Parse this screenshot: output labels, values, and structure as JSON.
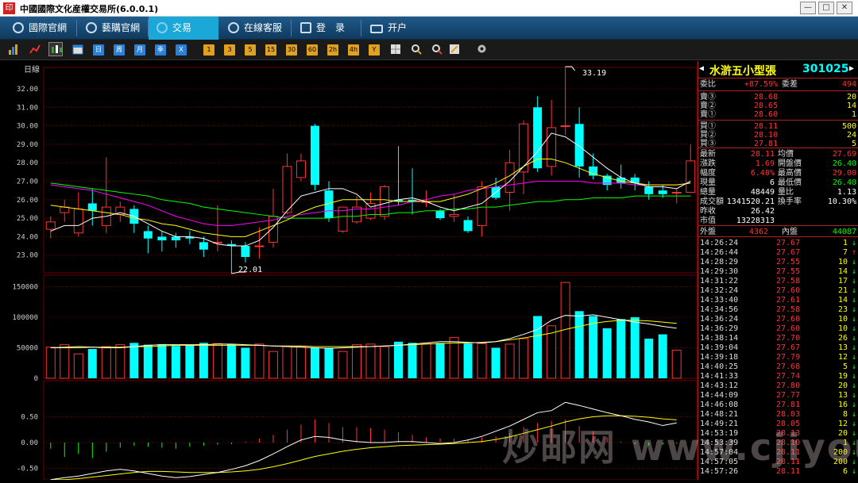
{
  "window": {
    "title": "中國國際文化産權交易所(6.0.0.1)",
    "minimize": "—",
    "maximize": "□",
    "close": "✕"
  },
  "nav": {
    "tabs": [
      {
        "label": "國際官網",
        "icon": "globe-icon"
      },
      {
        "label": "藝購官網",
        "icon": "link-icon"
      },
      {
        "label": "交易",
        "icon": "dollar-icon"
      },
      {
        "label": "在線客服",
        "icon": "chat-icon"
      },
      {
        "label": "登　录",
        "icon": "login-icon"
      },
      {
        "label": "开户",
        "icon": "account-icon"
      }
    ]
  },
  "toolbar": {
    "period_buttons": [
      "日",
      "周",
      "月",
      "季",
      "X"
    ],
    "minute_buttons": [
      "1",
      "3",
      "5",
      "15",
      "30",
      "60",
      "2h",
      "4h",
      "Y"
    ]
  },
  "chart": {
    "period_label": "日線",
    "price_axis": [
      "32.00",
      "31.00",
      "30.00",
      "29.00",
      "28.00",
      "27.00",
      "26.00",
      "25.00",
      "24.00",
      "23.00"
    ],
    "volume_axis": [
      "150000",
      "100000",
      "50000",
      "0"
    ],
    "indicator_axis": [
      "0.50",
      "0.00",
      "-0.50"
    ],
    "high_label": "33.19",
    "low_label": "22.01",
    "colors": {
      "up": "#ff3333",
      "down": "#00ffff",
      "ma5": "#ffffff",
      "ma10": "#ffff00",
      "ma20": "#ff00ff",
      "ma60": "#00ff00",
      "grid": "#6a0000"
    }
  },
  "chart_data": {
    "type": "candlestick",
    "ylim": [
      22.5,
      33.2
    ],
    "candles": [
      [
        24.4,
        24.8,
        23.9,
        25.1
      ],
      [
        25.3,
        25.6,
        24.8,
        26.0
      ],
      [
        24.2,
        25.5,
        24.0,
        26.4
      ],
      [
        25.8,
        25.4,
        24.6,
        26.6
      ],
      [
        24.6,
        25.6,
        24.2,
        28.3
      ],
      [
        25.2,
        25.6,
        24.8,
        25.9
      ],
      [
        25.5,
        24.7,
        24.2,
        25.7
      ],
      [
        24.3,
        23.9,
        23.1,
        24.6
      ],
      [
        24.0,
        23.8,
        23.2,
        24.3
      ],
      [
        24.0,
        23.8,
        23.4,
        24.2
      ],
      [
        24.0,
        23.9,
        23.6,
        24.3
      ],
      [
        23.7,
        23.3,
        22.9,
        24.0
      ],
      [
        23.7,
        23.7,
        23.2,
        25.7
      ],
      [
        23.6,
        23.5,
        22.0,
        23.8
      ],
      [
        23.5,
        22.9,
        22.6,
        23.7
      ],
      [
        23.5,
        23.5,
        22.8,
        24.5
      ],
      [
        23.7,
        25.1,
        23.4,
        26.6
      ],
      [
        25.3,
        27.8,
        25.2,
        28.5
      ],
      [
        27.2,
        28.1,
        27.0,
        28.5
      ],
      [
        30.0,
        26.8,
        26.5,
        30.1
      ],
      [
        26.5,
        25.0,
        24.8,
        27.0
      ],
      [
        24.3,
        25.6,
        24.2,
        25.6
      ],
      [
        24.8,
        25.6,
        24.7,
        26.2
      ],
      [
        25.0,
        25.8,
        24.9,
        26.4
      ],
      [
        25.1,
        26.7,
        24.9,
        26.8
      ],
      [
        26.0,
        25.9,
        25.7,
        28.9
      ],
      [
        26.0,
        25.9,
        25.2,
        27.7
      ],
      [
        25.9,
        25.9,
        25.6,
        26.5
      ],
      [
        25.4,
        25.0,
        24.9,
        25.5
      ],
      [
        25.1,
        25.2,
        24.8,
        26.3
      ],
      [
        24.9,
        24.3,
        24.2,
        25.1
      ],
      [
        24.6,
        26.7,
        24.0,
        27.0
      ],
      [
        26.7,
        26.1,
        26.0,
        27.2
      ],
      [
        26.4,
        28.0,
        25.4,
        28.7
      ],
      [
        27.5,
        30.1,
        26.3,
        30.3
      ],
      [
        31.0,
        27.7,
        27.5,
        31.6
      ],
      [
        27.8,
        29.9,
        27.3,
        31.4
      ],
      [
        30.0,
        30.0,
        29.5,
        33.2
      ],
      [
        30.1,
        27.8,
        27.2,
        31.0
      ],
      [
        27.8,
        27.3,
        27.1,
        28.5
      ],
      [
        27.3,
        26.8,
        26.5,
        27.4
      ],
      [
        27.2,
        26.9,
        26.6,
        27.9
      ],
      [
        27.2,
        26.9,
        26.5,
        27.4
      ],
      [
        26.7,
        26.3,
        26.0,
        27.0
      ],
      [
        26.5,
        26.3,
        26.1,
        26.8
      ],
      [
        26.4,
        26.4,
        25.8,
        26.6
      ],
      [
        26.4,
        28.1,
        26.4,
        29.0
      ]
    ],
    "volume": [
      51000,
      55000,
      40000,
      48000,
      52000,
      55000,
      58000,
      55000,
      56000,
      53000,
      54000,
      58000,
      57000,
      56000,
      50000,
      56000,
      44000,
      52000,
      52000,
      50000,
      50000,
      44000,
      55000,
      56000,
      52000,
      60000,
      58000,
      57000,
      58000,
      67000,
      57000,
      57000,
      50000,
      56000,
      65000,
      102000,
      86000,
      157000,
      110000,
      102000,
      82000,
      97000,
      100000,
      65000,
      72000,
      46000
    ],
    "ma5": [
      24.3,
      24.6,
      24.6,
      25.0,
      25.1,
      25.3,
      25.1,
      24.7,
      24.3,
      24.0,
      24.0,
      23.9,
      23.6,
      23.5,
      23.5,
      23.8,
      24.5,
      25.4,
      26.2,
      26.4,
      26.6,
      26.6,
      26.3,
      25.6,
      25.8,
      26.0,
      26.1,
      25.9,
      25.6,
      25.4,
      25.6,
      25.8,
      26.4,
      27.0,
      27.8,
      28.6,
      29.6,
      29.4,
      28.9,
      28.3,
      27.7,
      27.2,
      26.9,
      26.7,
      26.7,
      26.6,
      27.0
    ],
    "ma10": [
      25.7,
      25.6,
      25.5,
      25.4,
      25.3,
      25.2,
      25.0,
      24.9,
      24.7,
      24.6,
      24.4,
      24.2,
      24.1,
      24.0,
      24.0,
      24.3,
      24.6,
      24.9,
      25.3,
      25.6,
      25.8,
      26.0,
      26.0,
      26.0,
      26.0,
      25.9,
      25.9,
      25.9,
      25.9,
      26.1,
      26.3,
      26.6,
      26.9,
      27.3,
      27.8,
      28.2,
      28.2,
      28.0,
      27.7,
      27.4,
      27.2,
      27.0,
      26.9,
      26.8,
      26.8,
      26.8,
      26.9
    ],
    "ma20": [
      26.8,
      26.7,
      26.6,
      26.5,
      26.3,
      26.1,
      25.9,
      25.7,
      25.4,
      25.1,
      24.9,
      24.7,
      24.6,
      24.6,
      24.7,
      24.8,
      24.9,
      25.1,
      25.2,
      25.3,
      25.4,
      25.4,
      25.5,
      25.5,
      25.6,
      25.7,
      25.9,
      26.0,
      26.2,
      26.3,
      26.5,
      26.6,
      26.7,
      26.8,
      26.9,
      27.0,
      27.0,
      27.0,
      27.0,
      26.9,
      26.9,
      26.9,
      26.8,
      26.8,
      26.8,
      26.8,
      26.9
    ],
    "ma60": [
      26.9,
      26.8,
      26.7,
      26.6,
      26.5,
      26.4,
      26.3,
      26.2,
      26.0,
      25.9,
      25.8,
      25.6,
      25.5,
      25.4,
      25.3,
      25.2,
      25.1,
      25.0,
      25.0,
      25.0,
      25.0,
      25.1,
      25.1,
      25.2,
      25.2,
      25.3,
      25.3,
      25.4,
      25.4,
      25.5,
      25.5,
      25.6,
      25.6,
      25.7,
      25.8,
      25.9,
      25.9,
      26.0,
      26.0,
      26.1,
      26.1,
      26.1,
      26.2,
      26.2,
      26.2,
      26.2,
      26.2
    ],
    "vol_ma5": [
      50000,
      51000,
      52000,
      51000,
      50000,
      50000,
      52000,
      54000,
      55000,
      55000,
      55000,
      55000,
      56000,
      56000,
      55000,
      54000,
      53000,
      52000,
      51000,
      50000,
      49000,
      50000,
      51000,
      52000,
      53000,
      54000,
      56000,
      58000,
      60000,
      60000,
      59000,
      58000,
      60000,
      65000,
      72000,
      80000,
      95000,
      103000,
      102000,
      104000,
      100000,
      96000,
      92000,
      89000,
      85000,
      82000
    ],
    "vol_ma10": [
      50000,
      50000,
      50000,
      51000,
      51000,
      51000,
      52000,
      52000,
      53000,
      54000,
      54000,
      54000,
      54000,
      54000,
      54000,
      54000,
      53000,
      53000,
      53000,
      52000,
      52000,
      52000,
      52000,
      52000,
      53000,
      54000,
      55000,
      56000,
      57000,
      58000,
      58000,
      59000,
      60000,
      63000,
      66000,
      70000,
      74000,
      80000,
      85000,
      90000,
      93000,
      95000,
      95000,
      94000,
      92000,
      90000
    ],
    "macd_bars": [
      -0.12,
      -0.28,
      -0.22,
      -0.3,
      -0.18,
      -0.1,
      -0.06,
      -0.08,
      -0.1,
      -0.12,
      -0.08,
      -0.06,
      -0.04,
      -0.03,
      0.02,
      0.08,
      0.15,
      0.25,
      0.35,
      0.45,
      0.38,
      0.3,
      0.3,
      0.28,
      0.25,
      0.2,
      0.15,
      0.1,
      0.08,
      0.08,
      0.06,
      0.1,
      0.12,
      0.18,
      0.3,
      0.38,
      0.42,
      0.45,
      0.32,
      0.22,
      0.1,
      0.02,
      -0.03,
      -0.06,
      -0.04,
      -0.02
    ],
    "dif": [
      -0.72,
      -0.68,
      -0.65,
      -0.6,
      -0.55,
      -0.52,
      -0.55,
      -0.6,
      -0.65,
      -0.68,
      -0.66,
      -0.62,
      -0.58,
      -0.52,
      -0.45,
      -0.35,
      -0.22,
      -0.08,
      0.05,
      0.12,
      0.1,
      0.05,
      0.02,
      0.0,
      0.0,
      0.02,
      0.02,
      0.0,
      -0.02,
      0.0,
      0.05,
      0.12,
      0.22,
      0.32,
      0.45,
      0.58,
      0.62,
      0.78,
      0.72,
      0.65,
      0.58,
      0.52,
      0.45,
      0.4,
      0.33,
      0.38
    ],
    "dea": [
      -0.72,
      -0.72,
      -0.7,
      -0.67,
      -0.64,
      -0.61,
      -0.58,
      -0.56,
      -0.56,
      -0.57,
      -0.58,
      -0.58,
      -0.58,
      -0.57,
      -0.55,
      -0.52,
      -0.47,
      -0.41,
      -0.34,
      -0.27,
      -0.22,
      -0.17,
      -0.13,
      -0.1,
      -0.08,
      -0.06,
      -0.05,
      -0.04,
      -0.03,
      -0.02,
      0.0,
      0.02,
      0.06,
      0.11,
      0.18,
      0.25,
      0.32,
      0.4,
      0.46,
      0.5,
      0.52,
      0.52,
      0.51,
      0.49,
      0.46,
      0.44
    ]
  },
  "quote": {
    "name": "水滸五小型張",
    "code": "301025",
    "weibi_label": "委比",
    "weibi": "+87.59%",
    "weicha_label": "委差",
    "weicha": "494",
    "sells": [
      {
        "label": "賣③",
        "price": "28.68",
        "vol": "20"
      },
      {
        "label": "賣②",
        "price": "28.65",
        "vol": "14"
      },
      {
        "label": "賣①",
        "price": "28.60",
        "vol": "1"
      }
    ],
    "buys": [
      {
        "label": "買①",
        "price": "28.11",
        "vol": "500"
      },
      {
        "label": "買②",
        "price": "28.10",
        "vol": "24"
      },
      {
        "label": "買③",
        "price": "27.81",
        "vol": "5"
      }
    ],
    "stats": [
      {
        "l1": "最新",
        "v1": "28.11",
        "l2": "均價",
        "v2": "27.69",
        "c1": "#ff3333",
        "c2": "#ff3333"
      },
      {
        "l1": "漲跌",
        "v1": "1.69",
        "l2": "開盤價",
        "v2": "26.40",
        "c1": "#ff3333",
        "c2": "#00ff00"
      },
      {
        "l1": "幅度",
        "v1": "6.40%",
        "l2": "最高價",
        "v2": "29.00",
        "c1": "#ff3333",
        "c2": "#ff3333"
      },
      {
        "l1": "現量",
        "v1": "6",
        "l2": "最低價",
        "v2": "26.40",
        "c1": "#ffffff",
        "c2": "#00ff00"
      },
      {
        "l1": "總量",
        "v1": "48449",
        "l2": "量比",
        "v2": "1.13",
        "c1": "#ffffff",
        "c2": "#ffffff"
      },
      {
        "l1": "成交額",
        "v1": "1341520.21",
        "l2": "換手率",
        "v2": "10.30%",
        "c1": "#ffffff",
        "c2": "#ffffff"
      },
      {
        "l1": "昨收",
        "v1": "26.42",
        "l2": "",
        "v2": "",
        "c1": "#ffffff",
        "c2": "#ffffff"
      },
      {
        "l1": "市值",
        "v1": "13228313",
        "l2": "",
        "v2": "",
        "c1": "#ffffff",
        "c2": "#ffffff"
      }
    ],
    "outer_label": "外盤",
    "outer": "4362",
    "inner_label": "內盤",
    "inner": "44087",
    "ticks": [
      {
        "t": "14:26:24",
        "p": "27.67",
        "v": "1",
        "d": "↓"
      },
      {
        "t": "14:26:44",
        "p": "27.67",
        "v": "7",
        "d": "↑"
      },
      {
        "t": "14:28:29",
        "p": "27.55",
        "v": "10",
        "d": "↓"
      },
      {
        "t": "14:29:30",
        "p": "27.55",
        "v": "14",
        "d": "↓"
      },
      {
        "t": "14:31:22",
        "p": "27.58",
        "v": "17",
        "d": "↓"
      },
      {
        "t": "14:32:24",
        "p": "27.60",
        "v": "21",
        "d": "↓"
      },
      {
        "t": "14:33:40",
        "p": "27.61",
        "v": "14",
        "d": "↓"
      },
      {
        "t": "14:34:56",
        "p": "27.58",
        "v": "23",
        "d": "↓"
      },
      {
        "t": "14:36:24",
        "p": "27.60",
        "v": "10",
        "d": "↓"
      },
      {
        "t": "14:36:29",
        "p": "27.60",
        "v": "10",
        "d": "↓"
      },
      {
        "t": "14:38:14",
        "p": "27.70",
        "v": "26",
        "d": "↓"
      },
      {
        "t": "14:39:04",
        "p": "27.67",
        "v": "13",
        "d": "↓"
      },
      {
        "t": "14:39:18",
        "p": "27.79",
        "v": "12",
        "d": "↓"
      },
      {
        "t": "14:40:25",
        "p": "27.68",
        "v": "5",
        "d": "↓"
      },
      {
        "t": "14:41:33",
        "p": "27.74",
        "v": "19",
        "d": "↓"
      },
      {
        "t": "14:43:12",
        "p": "27.80",
        "v": "20",
        "d": "↓"
      },
      {
        "t": "14:44:09",
        "p": "27.77",
        "v": "13",
        "d": "↓"
      },
      {
        "t": "14:46:08",
        "p": "27.81",
        "v": "16",
        "d": "↓"
      },
      {
        "t": "14:48:21",
        "p": "28.03",
        "v": "8",
        "d": "↓"
      },
      {
        "t": "14:49:21",
        "p": "28.05",
        "v": "12",
        "d": "↓"
      },
      {
        "t": "14:53:19",
        "p": "28.13",
        "v": "20",
        "d": "↓"
      },
      {
        "t": "14:53:39",
        "p": "28.10",
        "v": "1",
        "d": "↓"
      },
      {
        "t": "14:57:04",
        "p": "28.11",
        "v": "200",
        "d": "↓"
      },
      {
        "t": "14:57:05",
        "p": "28.11",
        "v": "200",
        "d": "↓"
      },
      {
        "t": "14:57:26",
        "p": "28.11",
        "v": "6",
        "d": "↓"
      }
    ]
  },
  "watermark": "炒邮网 www.cjiyou.net"
}
